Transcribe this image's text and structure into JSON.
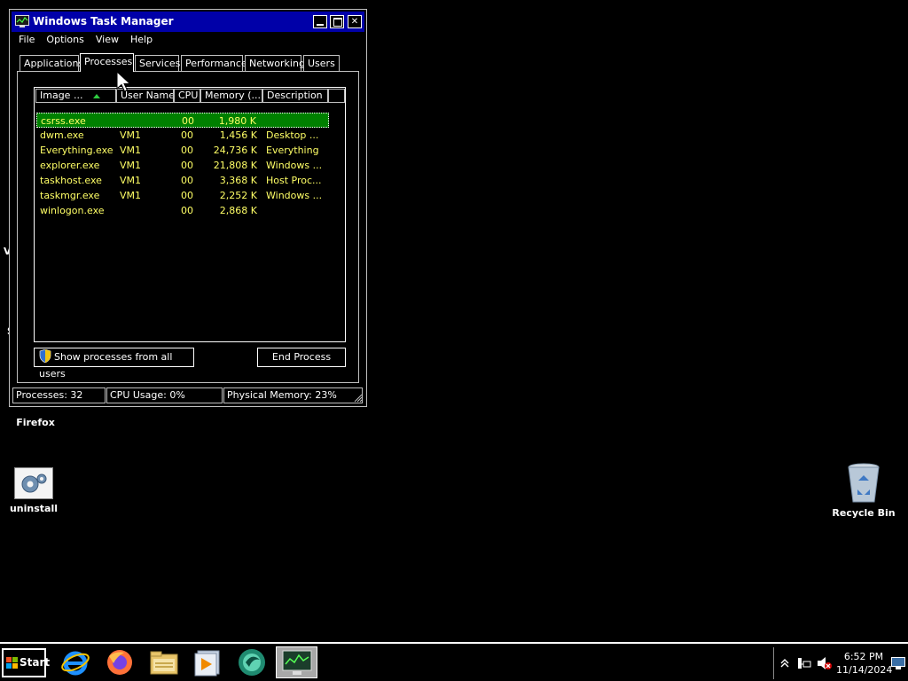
{
  "desktop": {
    "icons": [
      {
        "label": "Firefox"
      },
      {
        "label": "uninstall"
      },
      {
        "label": "Recycle Bin"
      }
    ],
    "edge_fragments": [
      "V",
      "S"
    ]
  },
  "window": {
    "title": "Windows Task Manager",
    "menu": [
      "File",
      "Options",
      "View",
      "Help"
    ],
    "tabs": [
      "Applications",
      "Processes",
      "Services",
      "Performance",
      "Networking",
      "Users"
    ],
    "active_tab": "Processes",
    "columns": [
      "Image ...",
      "User Name",
      "CPU",
      "Memory (...",
      "Description"
    ],
    "sort_column": "Image ...",
    "processes": [
      {
        "image": "csrss.exe",
        "user": "",
        "cpu": "00",
        "memory": "1,980 K",
        "description": ""
      },
      {
        "image": "dwm.exe",
        "user": "VM1",
        "cpu": "00",
        "memory": "1,456 K",
        "description": "Desktop ..."
      },
      {
        "image": "Everything.exe",
        "user": "VM1",
        "cpu": "00",
        "memory": "24,736 K",
        "description": "Everything"
      },
      {
        "image": "explorer.exe",
        "user": "VM1",
        "cpu": "00",
        "memory": "21,808 K",
        "description": "Windows ..."
      },
      {
        "image": "taskhost.exe",
        "user": "VM1",
        "cpu": "00",
        "memory": "3,368 K",
        "description": "Host Proc..."
      },
      {
        "image": "taskmgr.exe",
        "user": "VM1",
        "cpu": "00",
        "memory": "2,252 K",
        "description": "Windows ..."
      },
      {
        "image": "winlogon.exe",
        "user": "",
        "cpu": "00",
        "memory": "2,868 K",
        "description": ""
      }
    ],
    "selected_row": 0,
    "show_all_button": "Show processes from all users",
    "end_process_button": "End Process",
    "status": {
      "processes": "Processes: 32",
      "cpu": "CPU Usage: 0%",
      "memory": "Physical Memory: 23%"
    }
  },
  "taskbar": {
    "start_label": "Start",
    "apps": [
      "internet-explorer-icon",
      "firefox-icon",
      "file-explorer-icon",
      "media-player-icon",
      "app-icon",
      "task-manager-icon"
    ],
    "active_app": "task-manager-icon",
    "clock_time": "6:52 PM",
    "clock_date": "11/14/2024"
  },
  "colors": {
    "title_bar": "#0000a8",
    "row_text": "#ffff66",
    "selection": "#008000"
  }
}
